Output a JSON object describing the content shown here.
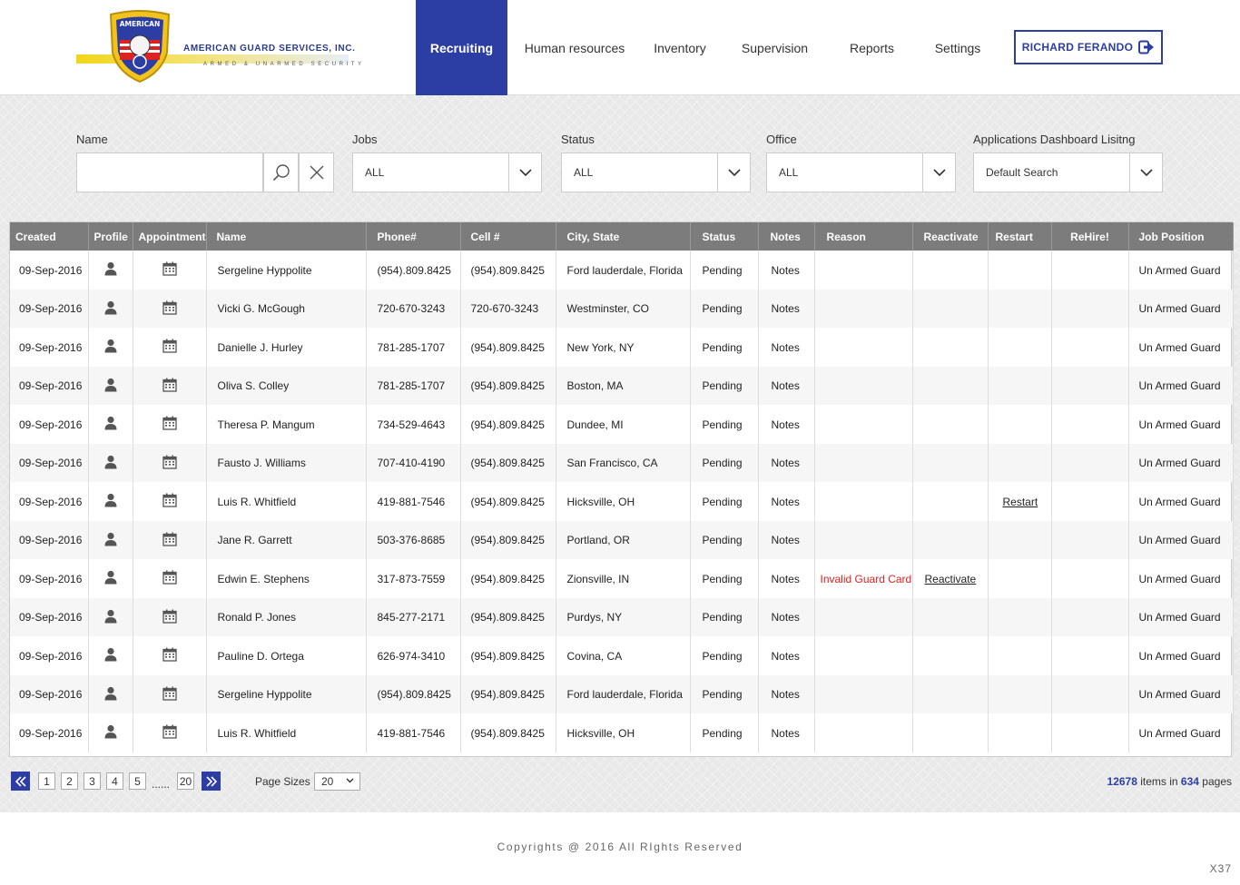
{
  "brand": {
    "name": "AMERICAN GUARD SERVICES, INC.",
    "tagline": "ARMED & UNARMED SECURITY",
    "shield_text": "AMERICAN"
  },
  "nav": {
    "items": [
      "Recruiting",
      "Human resources",
      "Inventory",
      "Supervision",
      "Reports",
      "Settings"
    ],
    "active": "Recruiting"
  },
  "user": {
    "name": "RICHARD FERANDO",
    "icon": "logout-icon"
  },
  "filters": {
    "name_label": "Name",
    "name_value": "",
    "jobs_label": "Jobs",
    "jobs_value": "ALL",
    "status_label": "Status",
    "status_value": "ALL",
    "office_label": "Office",
    "office_value": "ALL",
    "dashboard_label": "Applications Dashboard Lisitng",
    "dashboard_value": "Default Search"
  },
  "table": {
    "columns": [
      "Created",
      "Profile",
      "Appointment",
      "Name",
      "Phone#",
      "Cell #",
      "City, State",
      "Status",
      "Notes",
      "Reason",
      "Reactivate",
      "Restart",
      "ReHire!",
      "Job Position"
    ],
    "rows": [
      {
        "created": "09-Sep-2016",
        "name": "Sergeline Hyppolite",
        "phone": "(954).809.8425",
        "cell": "(954).809.8425",
        "city": "Ford lauderdale, Florida",
        "status": "Pending",
        "notes": "Notes",
        "reason": "",
        "reactivate": "",
        "restart": "",
        "rehire": "",
        "position": "Un Armed Guard"
      },
      {
        "created": "09-Sep-2016",
        "name": "Vicki G. McGough",
        "phone": "720-670-3243",
        "cell": "720-670-3243",
        "city": "Westminster, CO",
        "status": "Pending",
        "notes": "Notes",
        "reason": "",
        "reactivate": "",
        "restart": "",
        "rehire": "",
        "position": "Un Armed Guard"
      },
      {
        "created": "09-Sep-2016",
        "name": "Danielle J. Hurley",
        "phone": "781-285-1707",
        "cell": "(954).809.8425",
        "city": "New York, NY",
        "status": "Pending",
        "notes": "Notes",
        "reason": "",
        "reactivate": "",
        "restart": "",
        "rehire": "",
        "position": "Un Armed Guard"
      },
      {
        "created": "09-Sep-2016",
        "name": "Oliva S. Colley",
        "phone": "781-285-1707",
        "cell": "(954).809.8425",
        "city": "Boston, MA",
        "status": "Pending",
        "notes": "Notes",
        "reason": "",
        "reactivate": "",
        "restart": "",
        "rehire": "",
        "position": "Un Armed Guard"
      },
      {
        "created": "09-Sep-2016",
        "name": "Theresa P. Mangum",
        "phone": "734-529-4643",
        "cell": "(954).809.8425",
        "city": "Dundee, MI",
        "status": "Pending",
        "notes": "Notes",
        "reason": "",
        "reactivate": "",
        "restart": "",
        "rehire": "",
        "position": "Un Armed Guard"
      },
      {
        "created": "09-Sep-2016",
        "name": "Fausto J. Williams",
        "phone": "707-410-4190",
        "cell": "(954).809.8425",
        "city": "San Francisco, CA",
        "status": "Pending",
        "notes": "Notes",
        "reason": "",
        "reactivate": "",
        "restart": "",
        "rehire": "",
        "position": "Un Armed Guard"
      },
      {
        "created": "09-Sep-2016",
        "name": "Luis R. Whitfield",
        "phone": "419-881-7546",
        "cell": "(954).809.8425",
        "city": "Hicksville, OH",
        "status": "Pending",
        "notes": "Notes",
        "reason": "",
        "reactivate": "",
        "restart": "Restart",
        "rehire": "",
        "position": "Un Armed Guard"
      },
      {
        "created": "09-Sep-2016",
        "name": "Jane R. Garrett",
        "phone": "503-376-8685",
        "cell": "(954).809.8425",
        "city": "Portland, OR",
        "status": "Pending",
        "notes": "Notes",
        "reason": "",
        "reactivate": "",
        "restart": "",
        "rehire": "",
        "position": "Un Armed Guard"
      },
      {
        "created": "09-Sep-2016",
        "name": "Edwin E. Stephens",
        "phone": "317-873-7559",
        "cell": "(954).809.8425",
        "city": "Zionsville, IN",
        "status": "Pending",
        "notes": "Notes",
        "reason": "Invalid Guard Card",
        "reactivate": "Reactivate",
        "restart": "",
        "rehire": "",
        "position": "Un Armed Guard"
      },
      {
        "created": "09-Sep-2016",
        "name": "Ronald P. Jones",
        "phone": "845-277-2171",
        "cell": "(954).809.8425",
        "city": "Purdys, NY",
        "status": "Pending",
        "notes": "Notes",
        "reason": "",
        "reactivate": "",
        "restart": "",
        "rehire": "",
        "position": "Un Armed Guard"
      },
      {
        "created": "09-Sep-2016",
        "name": "Pauline D. Ortega",
        "phone": "626-974-3410",
        "cell": "(954).809.8425",
        "city": "Covina, CA",
        "status": "Pending",
        "notes": "Notes",
        "reason": "",
        "reactivate": "",
        "restart": "",
        "rehire": "",
        "position": "Un Armed Guard"
      },
      {
        "created": "09-Sep-2016",
        "name": "Sergeline Hyppolite",
        "phone": "(954).809.8425",
        "cell": "(954).809.8425",
        "city": "Ford lauderdale, Florida",
        "status": "Pending",
        "notes": "Notes",
        "reason": "",
        "reactivate": "",
        "restart": "",
        "rehire": "",
        "position": "Un Armed Guard"
      },
      {
        "created": "09-Sep-2016",
        "name": "Luis R. Whitfield",
        "phone": "419-881-7546",
        "cell": "(954).809.8425",
        "city": "Hicksville, OH",
        "status": "Pending",
        "notes": "Notes",
        "reason": "",
        "reactivate": "",
        "restart": "",
        "rehire": "",
        "position": "Un Armed Guard"
      }
    ]
  },
  "pagination": {
    "pages": [
      "1",
      "2",
      "3",
      "4",
      "5"
    ],
    "ellipsis": "......",
    "last_page": "20",
    "page_size_label": "Page Sizes",
    "page_size": "20",
    "total_items": "12678",
    "items_text": "items in",
    "total_pages": "634",
    "pages_text": "pages"
  },
  "footer": {
    "copyright": "Copyrights @ 2016 All RIghts Reserved",
    "corner": "X37"
  },
  "colors": {
    "accent": "#2c3ea3",
    "header_bg": "#7c7c7c",
    "reason": "#e02020"
  }
}
